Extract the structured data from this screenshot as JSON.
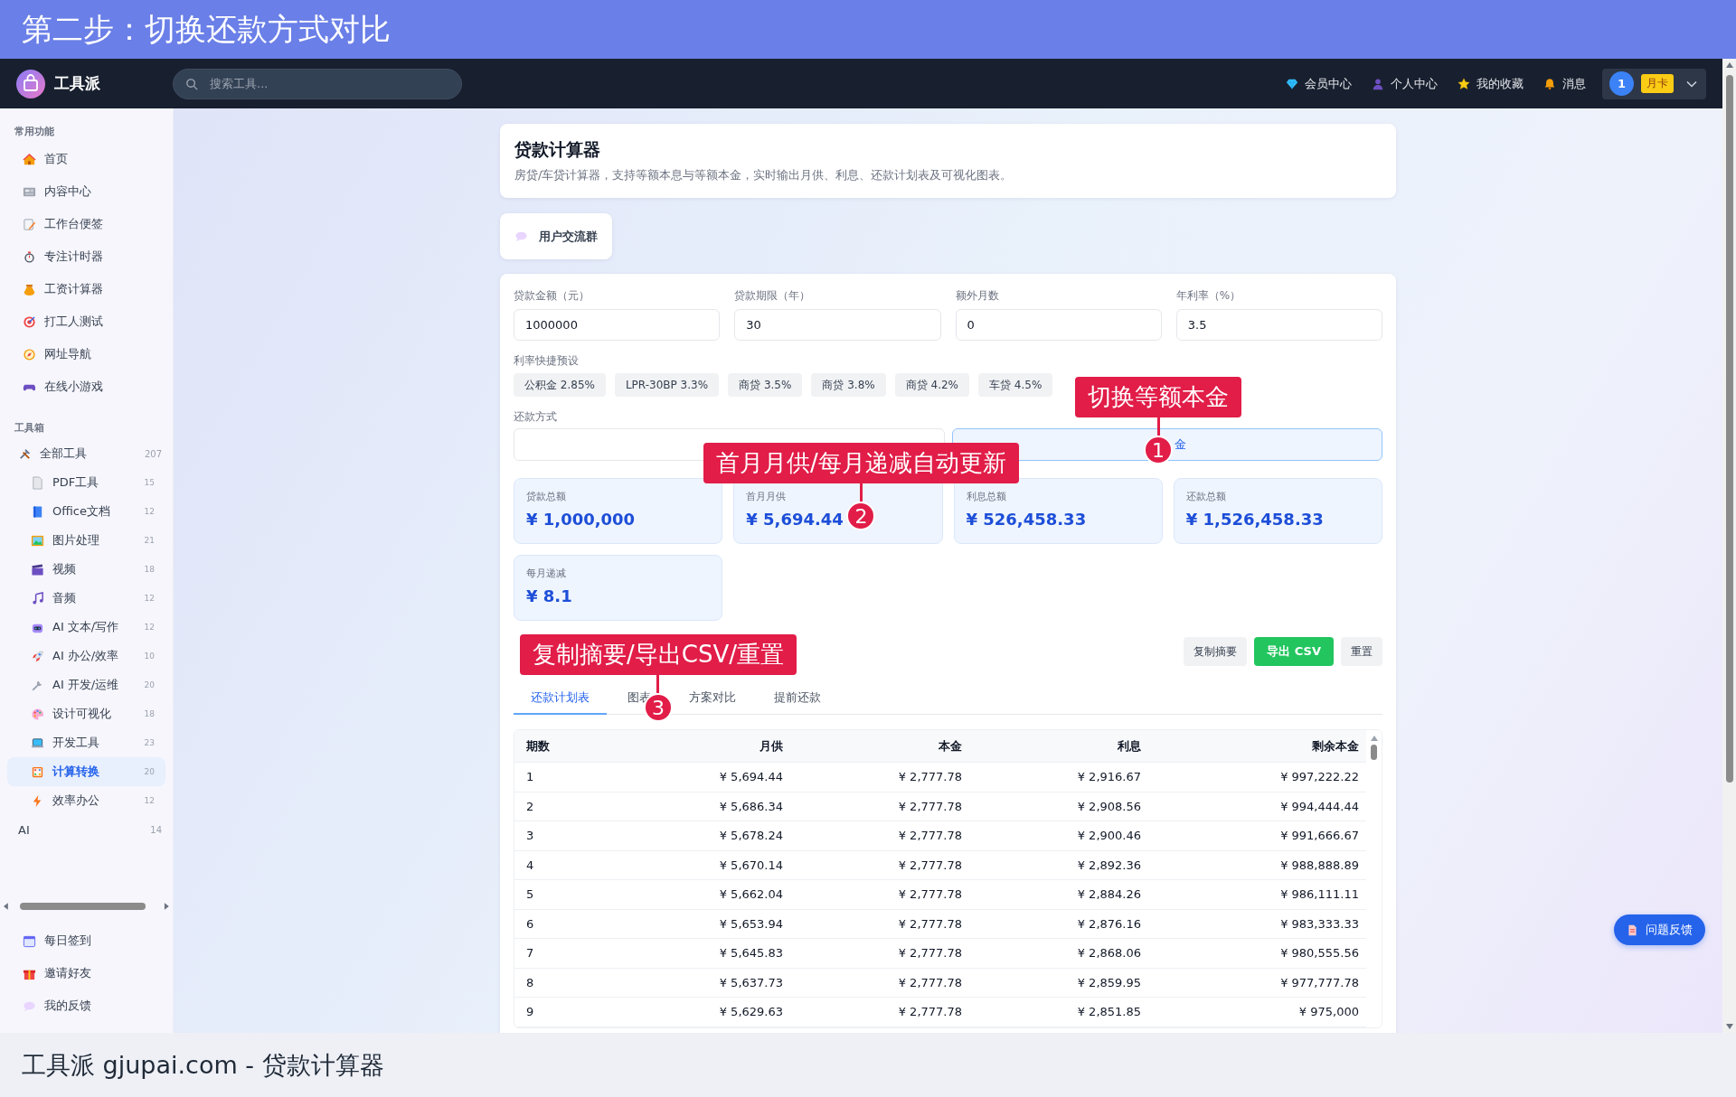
{
  "banner": {
    "title": "第二步：切换还款方式对比"
  },
  "navbar": {
    "brand": "工具派",
    "search": {
      "placeholder": "搜索工具..."
    },
    "links": [
      {
        "label": "会员中心"
      },
      {
        "label": "个人中心"
      },
      {
        "label": "我的收藏"
      },
      {
        "label": "消息"
      }
    ],
    "user": {
      "avatar": "1",
      "plan": "月卡"
    }
  },
  "sidebar": {
    "sections": [
      {
        "title": "常用功能",
        "items": [
          {
            "label": "首页",
            "selected": false
          },
          {
            "label": "内容中心",
            "selected": false
          },
          {
            "label": "工作台便签",
            "selected": false
          },
          {
            "label": "专注计时器",
            "selected": false
          },
          {
            "label": "工资计算器",
            "selected": false
          },
          {
            "label": "打工人测试",
            "selected": false
          },
          {
            "label": "网址导航",
            "selected": false
          },
          {
            "label": "在线小游戏",
            "selected": false
          }
        ]
      },
      {
        "title": "工具箱",
        "items": [
          {
            "label": "全部工具",
            "count": "207",
            "selected": false,
            "children": [
              {
                "label": "PDF工具",
                "count": "15",
                "selected": false
              },
              {
                "label": "Office文档",
                "count": "12",
                "selected": false
              },
              {
                "label": "图片处理",
                "count": "21",
                "selected": false
              },
              {
                "label": "视频",
                "count": "18",
                "selected": false
              },
              {
                "label": "音频",
                "count": "12",
                "selected": false
              },
              {
                "label": "AI 文本/写作",
                "count": "12",
                "selected": false
              },
              {
                "label": "AI 办公/效率",
                "count": "10",
                "selected": false
              },
              {
                "label": "AI 开发/运维",
                "count": "20",
                "selected": false
              },
              {
                "label": "设计可视化",
                "count": "18",
                "selected": false
              },
              {
                "label": "开发工具",
                "count": "23",
                "selected": false
              },
              {
                "label": "计算转换",
                "count": "20",
                "selected": true
              },
              {
                "label": "效率办公",
                "count": "12",
                "selected": false
              }
            ]
          },
          {
            "label": "AI",
            "count": "14",
            "selected": false
          }
        ]
      }
    ],
    "footer": [
      {
        "label": "每日签到",
        "selected": false
      },
      {
        "label": "邀请好友",
        "selected": false
      },
      {
        "label": "我的反馈",
        "selected": false
      }
    ]
  },
  "header_card": {
    "title": "贷款计算器",
    "description": "房贷/车贷计算器，支持等额本息与等额本金，实时输出月供、利息、还款计划表及可视化图表。"
  },
  "community": {
    "label": "用户交流群"
  },
  "form": {
    "fields": [
      {
        "label": "贷款金额（元）",
        "value": "1000000"
      },
      {
        "label": "贷款期限（年）",
        "value": "30"
      },
      {
        "label": "额外月数",
        "value": "0"
      },
      {
        "label": "年利率（%）",
        "value": "3.5"
      }
    ],
    "presets_label": "利率快捷预设",
    "presets": [
      "公积金 2.85%",
      "LPR-30BP 3.3%",
      "商贷 3.5%",
      "商贷 3.8%",
      "商贷 4.2%",
      "车贷 4.5%"
    ],
    "method_label": "还款方式",
    "methods": [
      {
        "selected": false
      },
      {
        "label": "金",
        "selected": true
      }
    ]
  },
  "stats": [
    {
      "label": "贷款总额",
      "value": "¥ 1,000,000"
    },
    {
      "label": "首月月供",
      "value": "¥ 5,694.44"
    },
    {
      "label": "利息总额",
      "value": "¥ 526,458.33"
    },
    {
      "label": "还款总额",
      "value": "¥ 1,526,458.33"
    },
    {
      "label": "每月递减",
      "value": "¥ 8.1"
    }
  ],
  "actions": [
    {
      "label": "复制摘要",
      "kind": "plain"
    },
    {
      "label": "导出 CSV",
      "kind": "primary"
    },
    {
      "label": "重置",
      "kind": "plain"
    }
  ],
  "tabs": [
    {
      "label": "还款计划表",
      "selected": true
    },
    {
      "label": "图表",
      "selected": false
    },
    {
      "label": "方案对比",
      "selected": false
    },
    {
      "label": "提前还款",
      "selected": false
    }
  ],
  "table": {
    "columns": [
      "期数",
      "月供",
      "本金",
      "利息",
      "剩余本金"
    ],
    "rows": [
      [
        "1",
        "¥ 5,694.44",
        "¥ 2,777.78",
        "¥ 2,916.67",
        "¥ 997,222.22"
      ],
      [
        "2",
        "¥ 5,686.34",
        "¥ 2,777.78",
        "¥ 2,908.56",
        "¥ 994,444.44"
      ],
      [
        "3",
        "¥ 5,678.24",
        "¥ 2,777.78",
        "¥ 2,900.46",
        "¥ 991,666.67"
      ],
      [
        "4",
        "¥ 5,670.14",
        "¥ 2,777.78",
        "¥ 2,892.36",
        "¥ 988,888.89"
      ],
      [
        "5",
        "¥ 5,662.04",
        "¥ 2,777.78",
        "¥ 2,884.26",
        "¥ 986,111.11"
      ],
      [
        "6",
        "¥ 5,653.94",
        "¥ 2,777.78",
        "¥ 2,876.16",
        "¥ 983,333.33"
      ],
      [
        "7",
        "¥ 5,645.83",
        "¥ 2,777.78",
        "¥ 2,868.06",
        "¥ 980,555.56"
      ],
      [
        "8",
        "¥ 5,637.73",
        "¥ 2,777.78",
        "¥ 2,859.95",
        "¥ 977,777.78"
      ],
      [
        "9",
        "¥ 5,629.63",
        "¥ 2,777.78",
        "¥ 2,851.85",
        "¥ 975,000"
      ]
    ]
  },
  "feedback": {
    "label": "问题反馈"
  },
  "callouts": [
    {
      "text": "切换等额本金",
      "step": "1"
    },
    {
      "text": "首月月供/每月递减自动更新",
      "step": "2"
    },
    {
      "text": "复制摘要/导出CSV/重置",
      "step": "3"
    }
  ],
  "caption": {
    "text": "工具派 gjupai.com - 贷款计算器"
  }
}
